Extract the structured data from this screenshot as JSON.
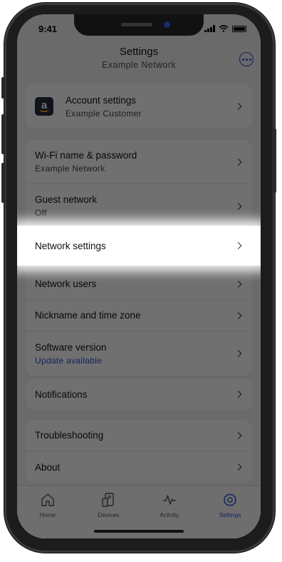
{
  "status_bar": {
    "time": "9:41"
  },
  "header": {
    "title": "Settings",
    "subtitle": "Example Network",
    "more_icon": "more-horizontal-icon"
  },
  "account": {
    "label": "Account settings",
    "sublabel": "Example Customer",
    "logo": "amazon-logo"
  },
  "network_group": {
    "items": [
      {
        "label": "Wi-Fi name & password",
        "sublabel": "Example Network"
      },
      {
        "label": "Guest network",
        "sublabel": "Off"
      },
      {
        "label": "Network settings"
      },
      {
        "label": "Network users"
      },
      {
        "label": "Nickname and time zone"
      },
      {
        "label": "Software version",
        "sublabel": "Update available"
      }
    ]
  },
  "notifications": {
    "label": "Notifications"
  },
  "support_group": {
    "items": [
      {
        "label": "Troubleshooting"
      },
      {
        "label": "About"
      }
    ]
  },
  "tabbar": {
    "tabs": [
      {
        "label": "Home",
        "icon": "home-icon"
      },
      {
        "label": "Devices",
        "icon": "devices-icon"
      },
      {
        "label": "Activity",
        "icon": "activity-icon"
      },
      {
        "label": "Settings",
        "icon": "settings-gear-icon",
        "active": true
      }
    ]
  },
  "colors": {
    "accent": "#2f4fd6",
    "highlight": "#ffffff",
    "dim_overlay": "rgba(0,0,0,0.56)"
  }
}
